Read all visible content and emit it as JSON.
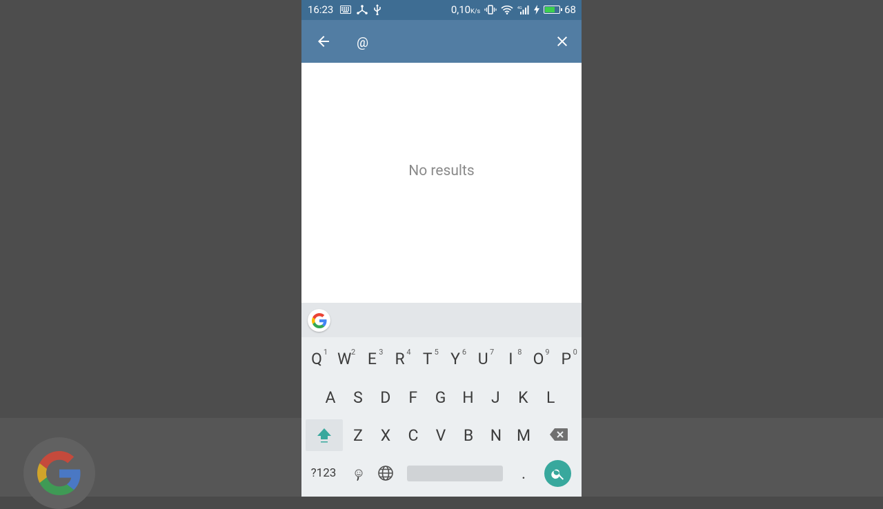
{
  "status_bar": {
    "time": "16:23",
    "network_speed": "0,10",
    "network_speed_unit": "K/s",
    "battery_level": "68",
    "battery_fraction": 0.68
  },
  "toolbar": {
    "search_value": "@",
    "back_icon": "arrow-left-icon",
    "close_icon": "close-icon"
  },
  "content": {
    "empty_message": "No results"
  },
  "keyboard": {
    "row1": [
      {
        "label": "Q",
        "hint": "1"
      },
      {
        "label": "W",
        "hint": "2"
      },
      {
        "label": "E",
        "hint": "3"
      },
      {
        "label": "R",
        "hint": "4"
      },
      {
        "label": "T",
        "hint": "5"
      },
      {
        "label": "Y",
        "hint": "6"
      },
      {
        "label": "U",
        "hint": "7"
      },
      {
        "label": "I",
        "hint": "8"
      },
      {
        "label": "O",
        "hint": "9"
      },
      {
        "label": "P",
        "hint": "0"
      }
    ],
    "row2": [
      "A",
      "S",
      "D",
      "F",
      "G",
      "H",
      "J",
      "K",
      "L"
    ],
    "row3": [
      "Z",
      "X",
      "C",
      "V",
      "B",
      "N",
      "M"
    ],
    "symbols_label": "?123",
    "comma_label": ",",
    "period_label": "."
  },
  "colors": {
    "toolbar": "#527da3",
    "status_bar": "#3e6d93",
    "keyboard_accent": "#38a89d",
    "battery_fill": "#3ccf4e"
  }
}
